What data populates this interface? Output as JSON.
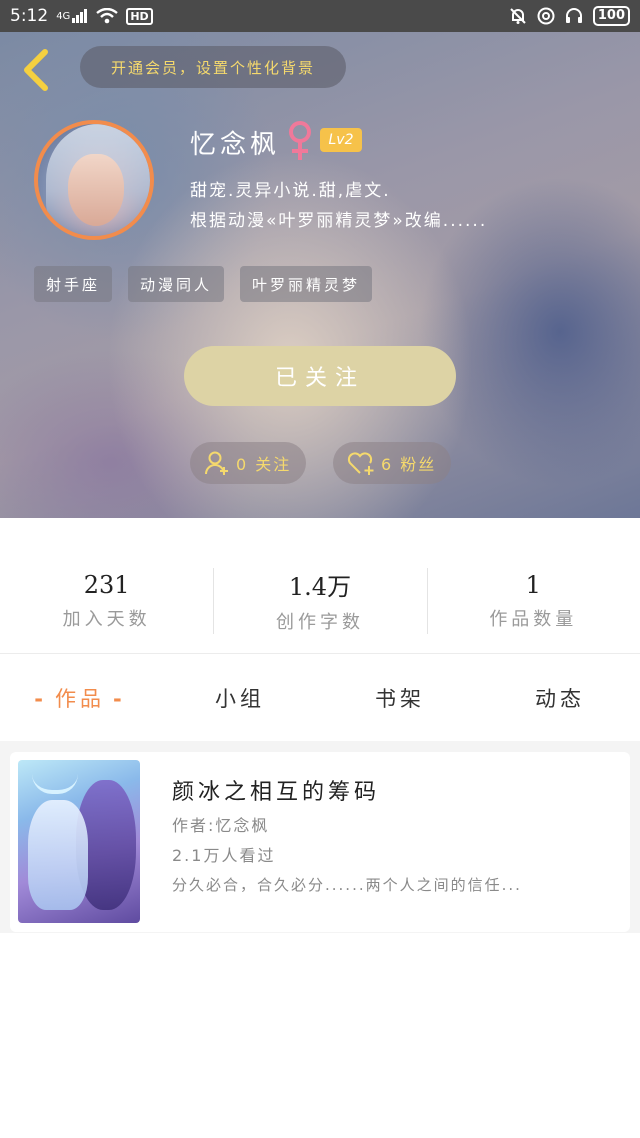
{
  "status_bar": {
    "time": "5:12",
    "signal": "4G",
    "network_badge": "HD",
    "battery": "100"
  },
  "header": {
    "vip_text": "开通会员，设置个性化背景",
    "username": "忆念枫",
    "level": "Lv2",
    "bio_line1": "甜宠.灵异小说.甜,虐文.",
    "bio_line2": "根据动漫«叶罗丽精灵梦»改编......",
    "tags": [
      "射手座",
      "动漫同人",
      "叶罗丽精灵梦"
    ],
    "follow_button": "已关注",
    "following": "0 关注",
    "fans": "6 粉丝"
  },
  "summary": [
    {
      "value": "231",
      "label": "加入天数"
    },
    {
      "value": "1.4万",
      "label": "创作字数"
    },
    {
      "value": "1",
      "label": "作品数量"
    }
  ],
  "tabs": [
    "作品",
    "小组",
    "书架",
    "动态"
  ],
  "book": {
    "title": "颜冰之相互的筹码",
    "author": "作者:忆念枫",
    "views": "2.1万人看过",
    "desc": "分久必合，合久必分......两个人之间的信任..."
  },
  "colors": {
    "accent": "#f28c4c",
    "badge": "#f6c24a",
    "follow_btn": "#ddd3a5",
    "header_text_yellow": "#f5d96d"
  }
}
